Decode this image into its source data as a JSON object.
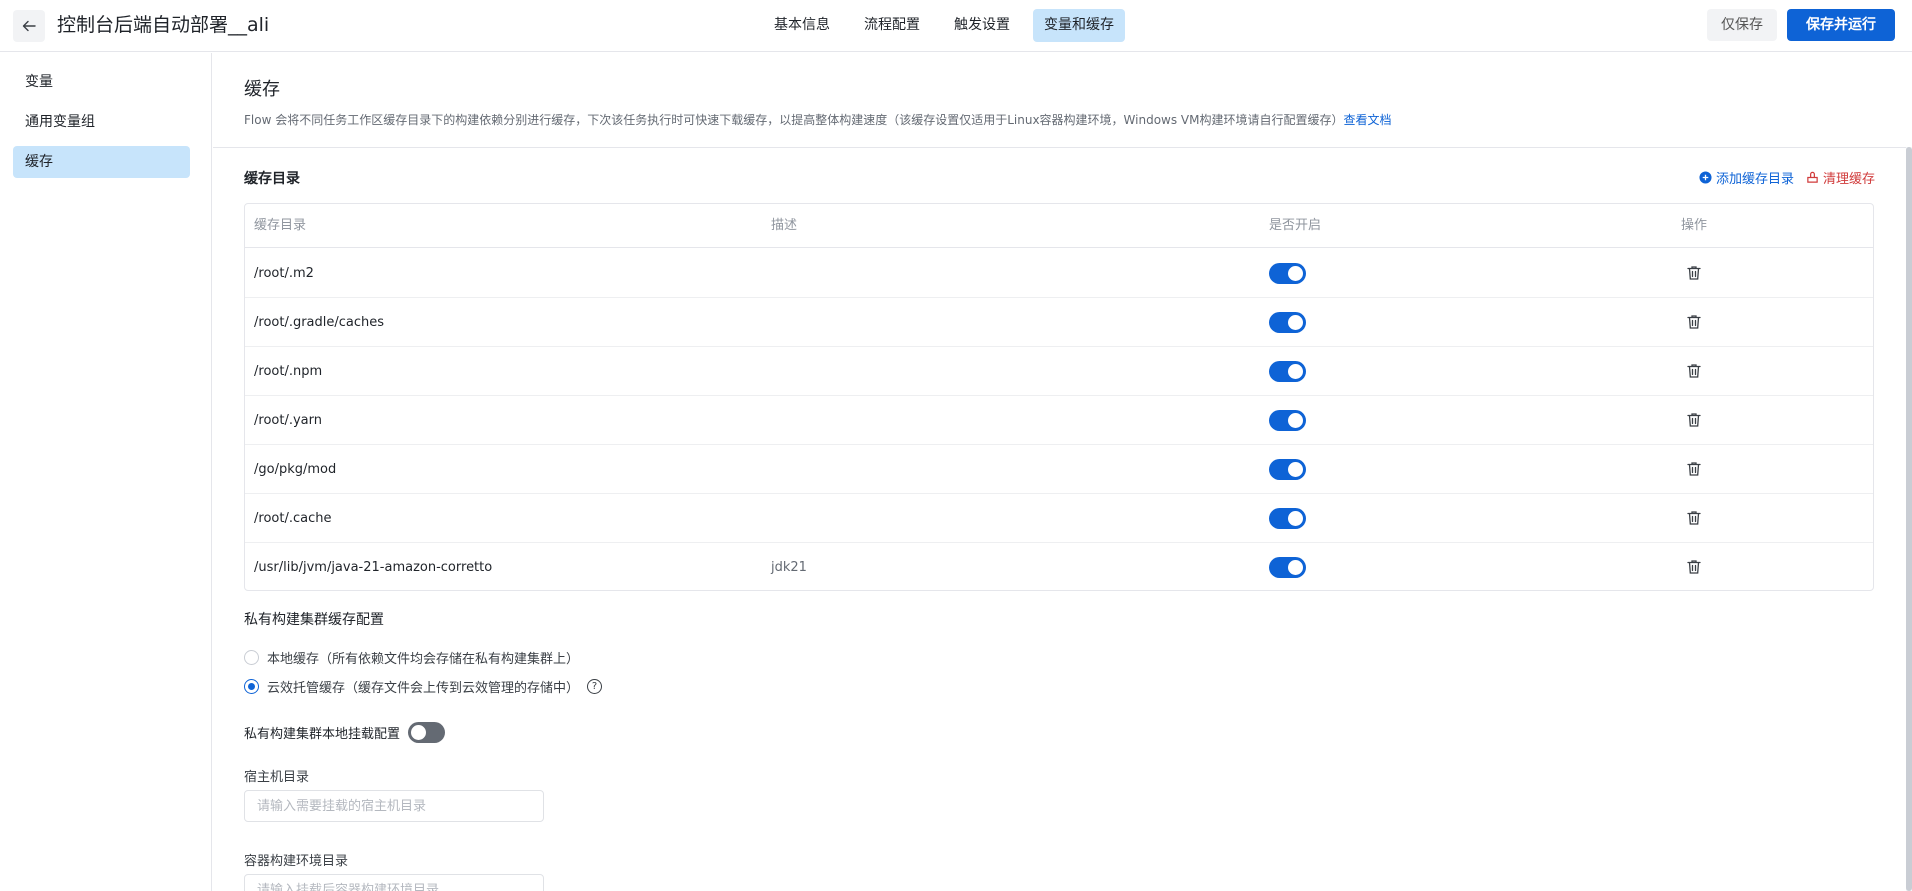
{
  "header": {
    "title": "控制台后端自动部署__ali",
    "tabs": [
      {
        "label": "基本信息"
      },
      {
        "label": "流程配置"
      },
      {
        "label": "触发设置"
      },
      {
        "label": "变量和缓存",
        "active": true
      }
    ],
    "save_only_label": "仅保存",
    "save_run_label": "保存并运行"
  },
  "sidebar": {
    "items": [
      {
        "label": "变量"
      },
      {
        "label": "通用变量组"
      },
      {
        "label": "缓存",
        "active": true
      }
    ]
  },
  "cache": {
    "title": "缓存",
    "description": "Flow 会将不同任务工作区缓存目录下的构建依赖分别进行缓存，下次该任务执行时可快速下载缓存，以提高整体构建速度（该缓存设置仅适用于Linux容器构建环境，Windows VM构建环境请自行配置缓存）",
    "doc_link": "查看文档",
    "dir_title": "缓存目录",
    "add_label": "添加缓存目录",
    "clear_label": "清理缓存",
    "table": {
      "headers": {
        "dir": "缓存目录",
        "desc": "描述",
        "enabled": "是否开启",
        "action": "操作"
      },
      "rows": [
        {
          "dir": "/root/.m2",
          "desc": "",
          "enabled": true
        },
        {
          "dir": "/root/.gradle/caches",
          "desc": "",
          "enabled": true
        },
        {
          "dir": "/root/.npm",
          "desc": "",
          "enabled": true
        },
        {
          "dir": "/root/.yarn",
          "desc": "",
          "enabled": true
        },
        {
          "dir": "/go/pkg/mod",
          "desc": "",
          "enabled": true
        },
        {
          "dir": "/root/.cache",
          "desc": "",
          "enabled": true
        },
        {
          "dir": "/usr/lib/jvm/java-21-amazon-corretto",
          "desc": "jdk21",
          "enabled": true
        }
      ]
    }
  },
  "private_cluster": {
    "title": "私有构建集群缓存配置",
    "options": [
      {
        "label": "本地缓存（所有依赖文件均会存储在私有构建集群上）",
        "checked": false
      },
      {
        "label": "云效托管缓存（缓存文件会上传到云效管理的存储中）",
        "checked": true
      }
    ],
    "help_glyph": "?",
    "mount_label": "私有构建集群本地挂载配置",
    "mount_enabled": false,
    "host_dir_label": "宿主机目录",
    "host_dir_placeholder": "请输入需要挂载的宿主机目录",
    "container_dir_label": "容器构建环境目录",
    "container_dir_placeholder": "请输入挂载后容器构建环境目录"
  },
  "colors": {
    "accent": "#0e63d6",
    "active_bg": "#c7e4fb",
    "danger": "#d03a3a"
  }
}
